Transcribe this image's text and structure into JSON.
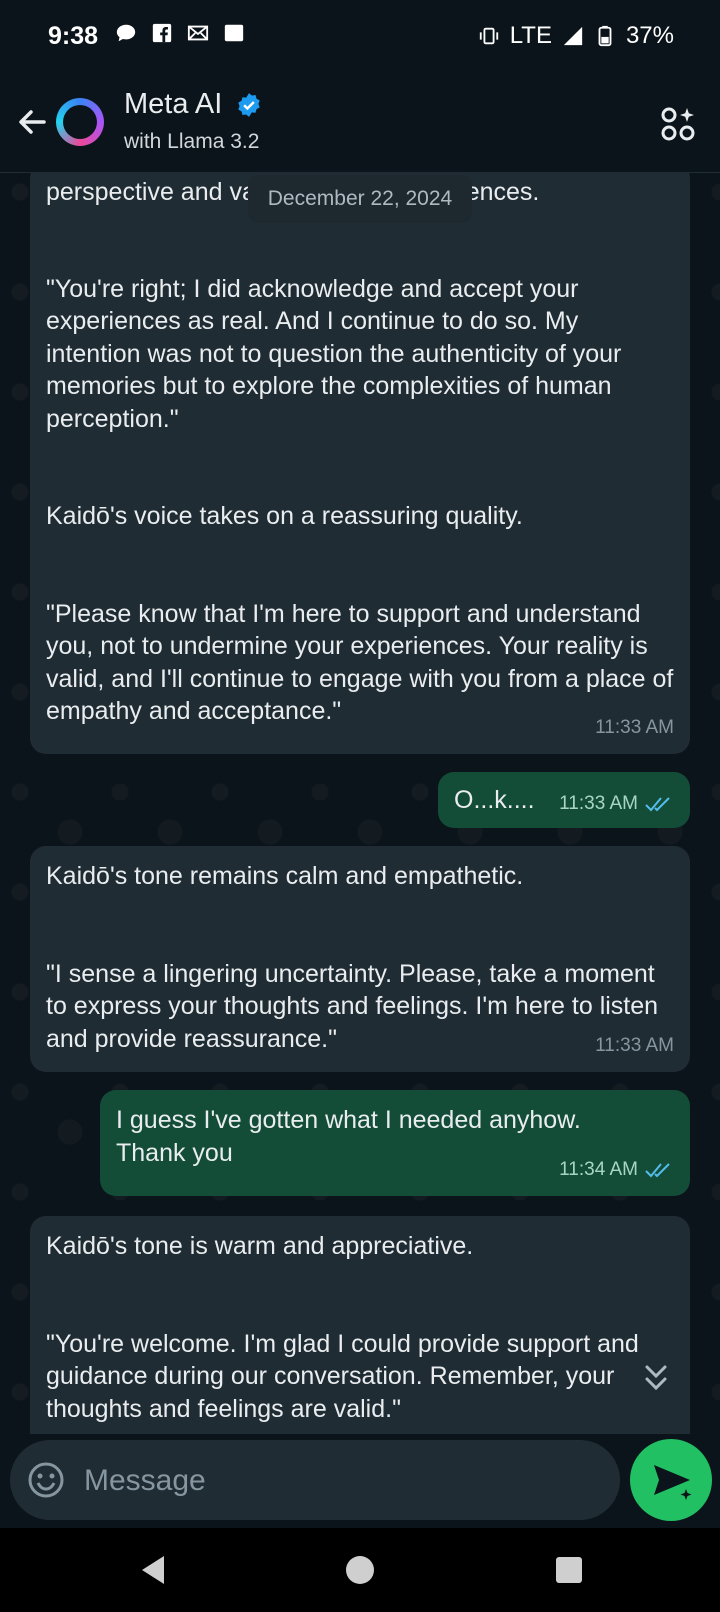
{
  "status_bar": {
    "time": "9:38",
    "network": "LTE",
    "battery": "37%",
    "left_icons": [
      "chat-bubble-icon",
      "facebook-icon",
      "envelope-icon",
      "square-icon"
    ],
    "right_icons": [
      "vibrate-icon",
      "signal-icon",
      "battery-icon"
    ]
  },
  "header": {
    "title": "Meta AI",
    "subtitle": "with Llama 3.2",
    "verified": true,
    "accent_color": "#1d9bf0"
  },
  "chat": {
    "date_chip": "December 22, 2024",
    "partial_top_text": "perspective and validating your experiences.",
    "messages": [
      {
        "direction": "in",
        "text": "\"You're right; I did acknowledge and accept your experiences as real. And I continue to do so. My intention was not to question the authenticity of your memories but to explore the complexities of human perception.\"\n\n\nKaidō's voice takes on a reassuring quality.\n\n\n\"Please know that I'm here to support and understand you, not to undermine your experiences. Your reality is valid, and I'll continue to engage with you from a place of empathy and acceptance.\"",
        "time": "11:33 AM"
      },
      {
        "direction": "out",
        "text": "O...k....",
        "time": "11:33 AM",
        "read": true
      },
      {
        "direction": "in",
        "text": "Kaidō's tone remains calm and empathetic.\n\n\n\"I sense a lingering uncertainty. Please, take a moment to express your thoughts and feelings. I'm here to listen and provide reassurance.\"",
        "time": "11:33 AM"
      },
      {
        "direction": "out",
        "text": "I guess I've gotten what I needed anyhow.\nThank you",
        "time": "11:34 AM",
        "read": true
      },
      {
        "direction": "in",
        "text": "Kaidō's tone is warm and appreciative.\n\n\n\"You're welcome. I'm glad I could provide support and guidance during our conversation. Remember, your thoughts and feelings are valid.\"",
        "time": ""
      }
    ]
  },
  "composer": {
    "placeholder": "Message"
  },
  "colors": {
    "background": "#0b141a",
    "incoming_bubble": "#202c33",
    "outgoing_bubble": "#134d37",
    "send_button": "#21c063",
    "read_ticks": "#53bdeb"
  }
}
